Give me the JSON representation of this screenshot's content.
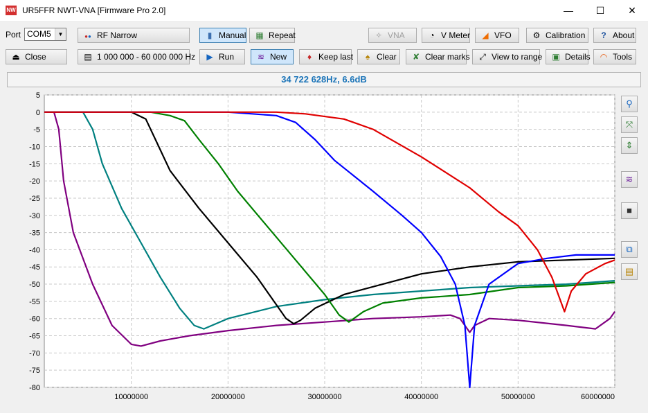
{
  "window": {
    "title": "UR5FFR NWT-VNA [Firmware Pro 2.0]",
    "icon_text": "NW",
    "minimize": "—",
    "maximize": "☐",
    "close": "✕"
  },
  "toolbar": {
    "port_label": "Port",
    "port_value": "COM5",
    "rf_narrow": "RF Narrow",
    "manual": "Manual",
    "repeat": "Repeat",
    "vna": "VNA",
    "vmeter": "V Meter",
    "vfo": "VFO",
    "calibration": "Calibration",
    "about": "About",
    "close": "Close",
    "range": "1 000 000 - 60 000 000 Hz",
    "run": "Run",
    "new": "New",
    "keep_last": "Keep last",
    "clear": "Clear",
    "clear_marks": "Clear marks",
    "view_to_range": "View to range",
    "details": "Details",
    "tools": "Tools"
  },
  "status": {
    "readout": "34 722 628Hz, 6.6dB"
  },
  "sidebar_icons": [
    "zoom-icon",
    "fit-icon",
    "vertical-scale-icon",
    "chart-icon",
    "camera-icon",
    "copy-icon",
    "paste-icon"
  ],
  "colors": {
    "accent": "#1b74b8",
    "red": "#e00000",
    "blue": "#0000ff",
    "purple": "#800080",
    "teal": "#008080",
    "black": "#000000",
    "green": "#008000"
  },
  "chart_data": {
    "type": "line",
    "xlim": [
      1000000,
      60000000
    ],
    "ylim": [
      -80,
      5
    ],
    "x_ticks": [
      "10000000",
      "20000000",
      "30000000",
      "40000000",
      "50000000",
      "60000000"
    ],
    "y_ticks": [
      "5",
      "0",
      "-5",
      "-10",
      "-15",
      "-20",
      "-25",
      "-30",
      "-35",
      "-40",
      "-45",
      "-50",
      "-55",
      "-60",
      "-65",
      "-70",
      "-75",
      "-80"
    ],
    "grid": true,
    "series": [
      {
        "color": "#800080",
        "points": [
          [
            1000000,
            0
          ],
          [
            2000000,
            0
          ],
          [
            2500000,
            -5
          ],
          [
            3000000,
            -20
          ],
          [
            4000000,
            -35
          ],
          [
            6000000,
            -50
          ],
          [
            8000000,
            -62
          ],
          [
            10000000,
            -67.5
          ],
          [
            11000000,
            -68
          ],
          [
            13000000,
            -66.5
          ],
          [
            16000000,
            -65
          ],
          [
            20000000,
            -63.5
          ],
          [
            25000000,
            -62
          ],
          [
            30000000,
            -61
          ],
          [
            35000000,
            -60
          ],
          [
            40000000,
            -59.5
          ],
          [
            43000000,
            -59
          ],
          [
            44000000,
            -60
          ],
          [
            45000000,
            -64
          ],
          [
            45500000,
            -62
          ],
          [
            47000000,
            -60
          ],
          [
            50000000,
            -60.5
          ],
          [
            55000000,
            -62
          ],
          [
            58000000,
            -63
          ],
          [
            59500000,
            -60
          ],
          [
            60000000,
            -58
          ]
        ]
      },
      {
        "color": "#008080",
        "points": [
          [
            1000000,
            0
          ],
          [
            5000000,
            0
          ],
          [
            6000000,
            -5
          ],
          [
            7000000,
            -15
          ],
          [
            9000000,
            -28
          ],
          [
            11000000,
            -38
          ],
          [
            13000000,
            -48
          ],
          [
            15000000,
            -57
          ],
          [
            16500000,
            -62
          ],
          [
            17500000,
            -63
          ],
          [
            20000000,
            -60
          ],
          [
            25000000,
            -56.5
          ],
          [
            30000000,
            -54.5
          ],
          [
            35000000,
            -53
          ],
          [
            40000000,
            -52
          ],
          [
            45000000,
            -51
          ],
          [
            50000000,
            -50.5
          ],
          [
            55000000,
            -50
          ],
          [
            60000000,
            -49
          ]
        ]
      },
      {
        "color": "#000000",
        "points": [
          [
            1000000,
            0
          ],
          [
            10000000,
            0
          ],
          [
            11500000,
            -2
          ],
          [
            12500000,
            -8
          ],
          [
            14000000,
            -17
          ],
          [
            17000000,
            -28
          ],
          [
            20000000,
            -38
          ],
          [
            23000000,
            -48
          ],
          [
            25000000,
            -56
          ],
          [
            26000000,
            -60
          ],
          [
            26800000,
            -61.5
          ],
          [
            27500000,
            -60.5
          ],
          [
            29000000,
            -57
          ],
          [
            32000000,
            -53
          ],
          [
            36000000,
            -50
          ],
          [
            40000000,
            -47
          ],
          [
            45000000,
            -45
          ],
          [
            50000000,
            -43.5
          ],
          [
            55000000,
            -43
          ],
          [
            60000000,
            -42.5
          ]
        ]
      },
      {
        "color": "#008000",
        "points": [
          [
            1000000,
            0
          ],
          [
            12000000,
            0
          ],
          [
            14000000,
            -1
          ],
          [
            15500000,
            -2.5
          ],
          [
            17000000,
            -8
          ],
          [
            19000000,
            -15
          ],
          [
            21000000,
            -23
          ],
          [
            24000000,
            -33
          ],
          [
            27000000,
            -43
          ],
          [
            30000000,
            -53
          ],
          [
            31500000,
            -59
          ],
          [
            32500000,
            -61
          ],
          [
            34000000,
            -58
          ],
          [
            36000000,
            -55.5
          ],
          [
            40000000,
            -54
          ],
          [
            45000000,
            -53
          ],
          [
            50000000,
            -51
          ],
          [
            55000000,
            -50.5
          ],
          [
            60000000,
            -49.5
          ]
        ]
      },
      {
        "color": "#0000ff",
        "points": [
          [
            1000000,
            0
          ],
          [
            20000000,
            0
          ],
          [
            25000000,
            -1
          ],
          [
            27000000,
            -3
          ],
          [
            29000000,
            -8
          ],
          [
            31000000,
            -14
          ],
          [
            35000000,
            -23
          ],
          [
            38000000,
            -30
          ],
          [
            40000000,
            -35
          ],
          [
            42000000,
            -42
          ],
          [
            43500000,
            -50
          ],
          [
            44500000,
            -62
          ],
          [
            45000000,
            -80
          ],
          [
            45500000,
            -62
          ],
          [
            47000000,
            -50
          ],
          [
            50000000,
            -44
          ],
          [
            53000000,
            -42.5
          ],
          [
            56000000,
            -41.5
          ],
          [
            60000000,
            -41.5
          ]
        ]
      },
      {
        "color": "#e00000",
        "points": [
          [
            1000000,
            0
          ],
          [
            25000000,
            0
          ],
          [
            28000000,
            -0.5
          ],
          [
            32000000,
            -2
          ],
          [
            35000000,
            -5
          ],
          [
            40000000,
            -13
          ],
          [
            45000000,
            -22
          ],
          [
            48000000,
            -29
          ],
          [
            50000000,
            -33
          ],
          [
            52000000,
            -40
          ],
          [
            53500000,
            -48
          ],
          [
            54800000,
            -58
          ],
          [
            55500000,
            -52
          ],
          [
            57000000,
            -47
          ],
          [
            59000000,
            -44
          ],
          [
            60000000,
            -43
          ]
        ]
      }
    ]
  }
}
